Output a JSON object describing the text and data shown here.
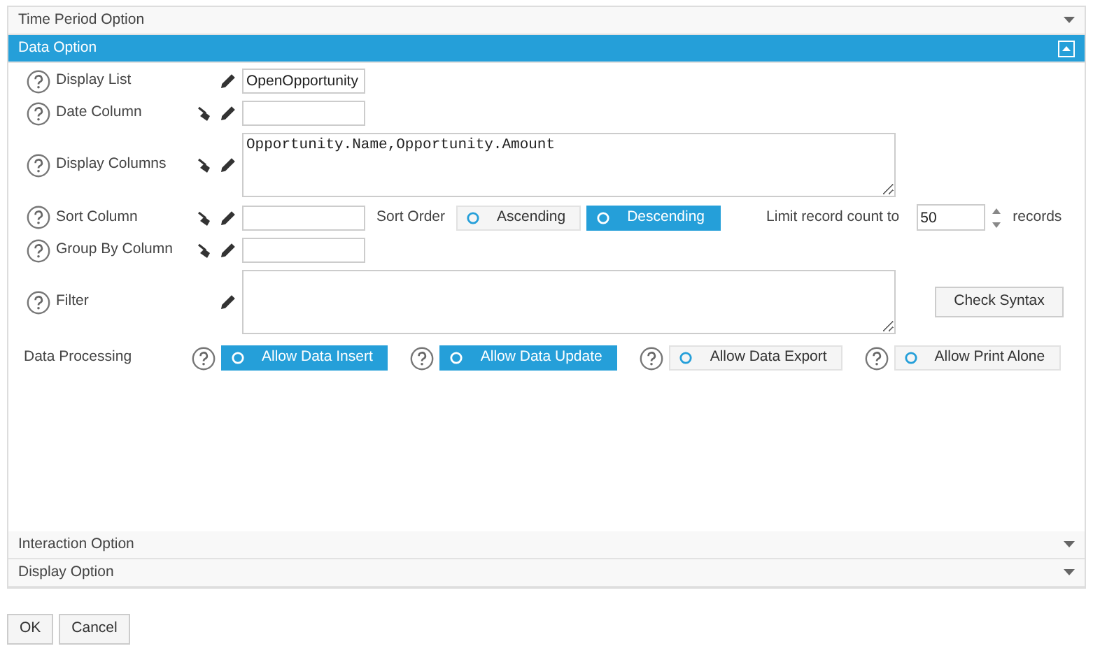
{
  "sections": [
    {
      "title": "Time Period Option",
      "expanded": false
    },
    {
      "title": "Data Option",
      "expanded": true
    },
    {
      "title": "Interaction Option",
      "expanded": false
    },
    {
      "title": "Display Option",
      "expanded": false
    }
  ],
  "data_option": {
    "fields": [
      {
        "label": "Display List",
        "clearable": false,
        "kind": "input",
        "value": "OpenOpportunity"
      },
      {
        "label": "Date Column",
        "clearable": true,
        "kind": "input"
      },
      {
        "label": "Display Columns",
        "clearable": true,
        "kind": "textarea",
        "value": "Opportunity.Name,Opportunity.Amount"
      },
      {
        "label": "Sort Column",
        "clearable": true,
        "kind": "sort"
      },
      {
        "label": "Group By Column",
        "clearable": true,
        "kind": "input"
      },
      {
        "label": "Filter",
        "clearable": false,
        "kind": "filter"
      }
    ],
    "sort_order": {
      "label": "Sort Order",
      "options": [
        {
          "label": "Ascending",
          "selected": false
        },
        {
          "label": "Descending",
          "selected": true
        }
      ]
    },
    "limit": {
      "label": "Limit record count to",
      "value": "50",
      "unit": "records"
    },
    "check_syntax": "Check Syntax",
    "data_processing": {
      "label": "Data Processing",
      "options": [
        {
          "label": "Allow Data Insert",
          "selected": true
        },
        {
          "label": "Allow Data Update",
          "selected": true
        },
        {
          "label": "Allow Data Export",
          "selected": false
        },
        {
          "label": "Allow Print Alone",
          "selected": false
        }
      ]
    }
  },
  "buttons": [
    "OK",
    "Cancel"
  ]
}
